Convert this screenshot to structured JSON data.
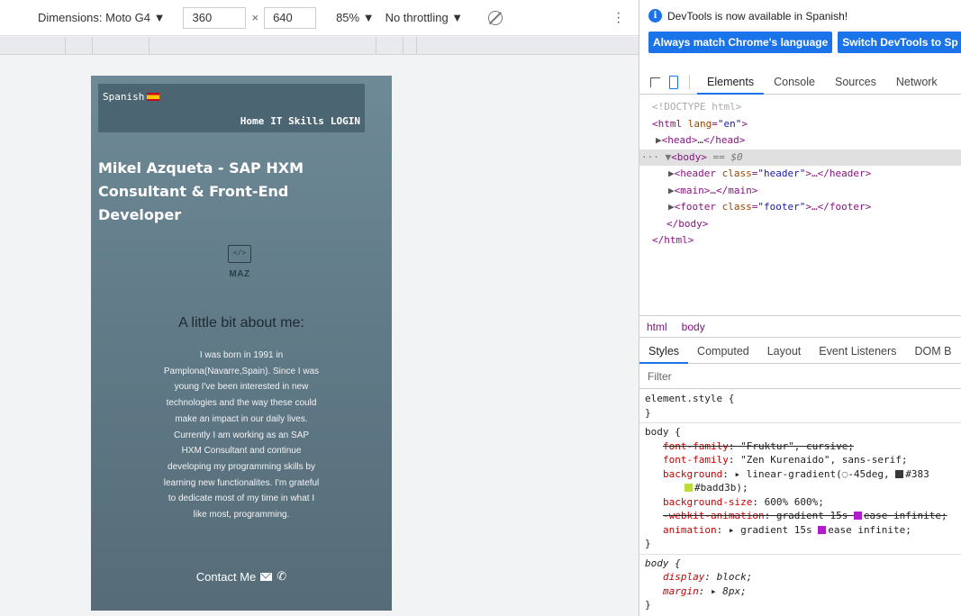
{
  "device_toolbar": {
    "device": "Dimensions: Moto G4 ▼",
    "width": "360",
    "x": "×",
    "height": "640",
    "zoom": "85% ▼",
    "throttling": "No throttling ▼"
  },
  "site": {
    "lang": "Spanish",
    "nav": [
      "Home",
      "IT Skills",
      "LOGIN"
    ],
    "title": "Mikel Azqueta - SAP HXM Consultant & Front-End Developer",
    "logo_code": "</>",
    "logo_text": "MAZ",
    "about_title": "A little bit about me:",
    "about_text": "I was born in 1991 in Pamplona(Navarre,Spain). Since I was young I've been interested in new technologies and the way these could make an impact in our daily lives. Currently I am working as an SAP HXM Consultant and continue developing my programming skills by learning new functionalites. I'm grateful to dedicate most of my time in what I like most, programming.",
    "contact": "Contact Me"
  },
  "devtools": {
    "info_message": "DevTools is now available in Spanish!",
    "btn_match": "Always match Chrome's language",
    "btn_switch": "Switch DevTools to Sp",
    "tabs": [
      "Elements",
      "Console",
      "Sources",
      "Network"
    ],
    "breadcrumbs": [
      "html",
      "body"
    ],
    "subtabs": [
      "Styles",
      "Computed",
      "Layout",
      "Event Listeners",
      "DOM B"
    ],
    "filter_placeholder": "Filter"
  },
  "colors": {
    "accent": "#1a73e8",
    "device_bg": "#617b88",
    "swatch_dark": "#383838",
    "swatch_green": "#badd3b",
    "swatch_purple": "#b01ccc"
  }
}
